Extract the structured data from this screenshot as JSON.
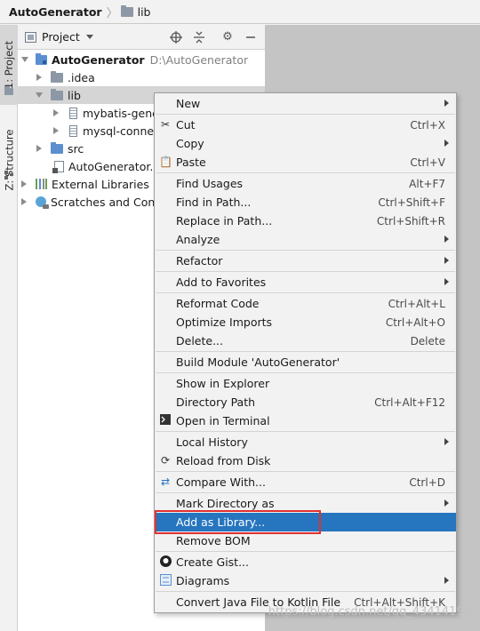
{
  "breadcrumb": {
    "root": "AutoGenerator",
    "current": "lib"
  },
  "tool_strip": {
    "project_tab": "1: Project",
    "structure_tab": "Z: Structure"
  },
  "project_panel": {
    "title": "Project",
    "tree": [
      {
        "label": "AutoGenerator",
        "path": "D:\\AutoGenerator",
        "icon": "module-folder-icon"
      },
      {
        "label": ".idea",
        "icon": "folder-icon"
      },
      {
        "label": "lib",
        "icon": "folder-icon",
        "selected": true
      },
      {
        "label": "mybatis-gene",
        "icon": "jar-icon"
      },
      {
        "label": "mysql-connec",
        "icon": "jar-icon"
      },
      {
        "label": "src",
        "icon": "folder-icon"
      },
      {
        "label": "AutoGenerator.i",
        "icon": "iml-file-icon"
      },
      {
        "label": "External Libraries",
        "icon": "library-icon"
      },
      {
        "label": "Scratches and Cons",
        "icon": "scratches-icon"
      }
    ]
  },
  "context_menu": {
    "items": [
      {
        "label": "New",
        "shortcut": "",
        "submenu": true
      },
      {
        "label": "Cut",
        "shortcut": "Ctrl+X",
        "icon": "scissors-icon"
      },
      {
        "label": "Copy",
        "shortcut": "",
        "submenu": true
      },
      {
        "label": "Paste",
        "shortcut": "Ctrl+V",
        "icon": "clipboard-icon"
      },
      {
        "label": "Find Usages",
        "shortcut": "Alt+F7"
      },
      {
        "label": "Find in Path...",
        "shortcut": "Ctrl+Shift+F"
      },
      {
        "label": "Replace in Path...",
        "shortcut": "Ctrl+Shift+R"
      },
      {
        "label": "Analyze",
        "shortcut": "",
        "submenu": true
      },
      {
        "label": "Refactor",
        "shortcut": "",
        "submenu": true
      },
      {
        "label": "Add to Favorites",
        "shortcut": "",
        "submenu": true
      },
      {
        "label": "Reformat Code",
        "shortcut": "Ctrl+Alt+L"
      },
      {
        "label": "Optimize Imports",
        "shortcut": "Ctrl+Alt+O"
      },
      {
        "label": "Delete...",
        "shortcut": "Delete"
      },
      {
        "label": "Build Module 'AutoGenerator'",
        "shortcut": ""
      },
      {
        "label": "Show in Explorer",
        "shortcut": ""
      },
      {
        "label": "Directory Path",
        "shortcut": "Ctrl+Alt+F12"
      },
      {
        "label": "Open in Terminal",
        "shortcut": "",
        "icon": "terminal-icon"
      },
      {
        "label": "Local History",
        "shortcut": "",
        "submenu": true
      },
      {
        "label": "Reload from Disk",
        "shortcut": "",
        "icon": "reload-icon"
      },
      {
        "label": "Compare With...",
        "shortcut": "Ctrl+D",
        "icon": "compare-icon"
      },
      {
        "label": "Mark Directory as",
        "shortcut": "",
        "submenu": true
      },
      {
        "label": "Add as Library...",
        "shortcut": "",
        "highlighted": true
      },
      {
        "label": "Remove BOM",
        "shortcut": ""
      },
      {
        "label": "Create Gist...",
        "shortcut": "",
        "icon": "github-icon"
      },
      {
        "label": "Diagrams",
        "shortcut": "",
        "submenu": true,
        "icon": "diagram-icon"
      },
      {
        "label": "Convert Java File to Kotlin File",
        "shortcut": "Ctrl+Alt+Shift+K"
      }
    ]
  },
  "watermark": "https://blog.csdn.net/qq_43414199",
  "colors": {
    "highlight": "#2675bf",
    "annotation_box": "#e2302f",
    "selection": "#d5d5d5"
  }
}
